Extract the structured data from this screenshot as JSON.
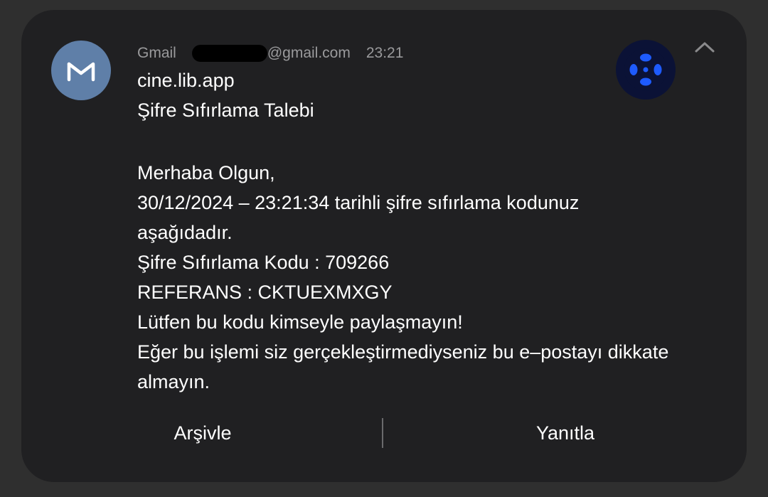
{
  "notification": {
    "app_name": "Gmail",
    "account_suffix": "@gmail.com",
    "time": "23:21",
    "sender": "cine.lib.app",
    "subject": "Şifre Sıfırlama Talebi",
    "body_lines": [
      "Merhaba Olgun,",
      "30/12/2024 – 23:21:34 tarihli şifre sıfırlama kodunuz",
      "aşağıdadır.",
      "Şifre Sıfırlama Kodu : 709266",
      "REFERANS : CKTUEXMXGY",
      "Lütfen bu kodu kimseyle paylaşmayın!",
      "Eğer bu işlemi siz gerçekleştirmediyseniz bu e–postayı dikkate",
      "almayın."
    ],
    "avatar_icon": "gmail-m-icon",
    "app_icon": "cine-lib-app-icon",
    "collapse_icon": "chevron-up-icon"
  },
  "actions": {
    "archive_label": "Arşivle",
    "reply_label": "Yanıtla"
  },
  "colors": {
    "background": "#2f2f2f",
    "card": "#202022",
    "avatar": "#5f7fa8",
    "app_icon_bg": "#0b1236",
    "app_icon_accent": "#1e5bff",
    "meta_text": "#9a9a9c",
    "primary_text": "#ffffff"
  }
}
